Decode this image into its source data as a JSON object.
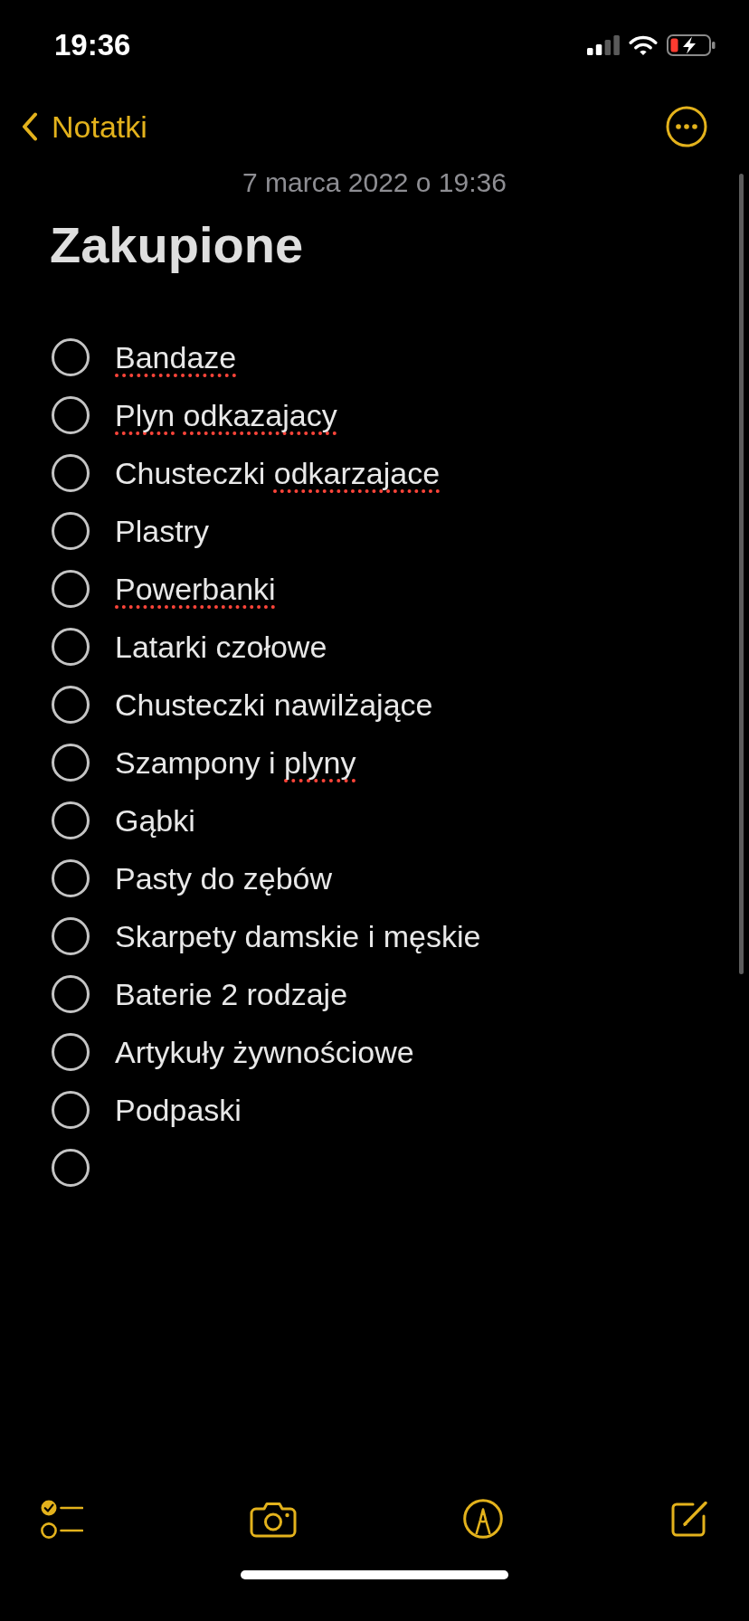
{
  "status_bar": {
    "time": "19:36"
  },
  "nav": {
    "back_label": "Notatki"
  },
  "note": {
    "date": "7 marca 2022 o 19:36",
    "title": "Zakupione",
    "checklist": [
      {
        "checked": false,
        "segments": [
          {
            "text": "Bandaze",
            "misspelled": true
          }
        ]
      },
      {
        "checked": false,
        "segments": [
          {
            "text": "Plyn ",
            "misspelled": true
          },
          {
            "text": "odkazajacy",
            "misspelled": true
          }
        ]
      },
      {
        "checked": false,
        "segments": [
          {
            "text": "Chusteczki ",
            "misspelled": false
          },
          {
            "text": "odkarzajace",
            "misspelled": true
          }
        ]
      },
      {
        "checked": false,
        "segments": [
          {
            "text": "Plastry",
            "misspelled": false
          }
        ]
      },
      {
        "checked": false,
        "segments": [
          {
            "text": "Powerbanki",
            "misspelled": true
          }
        ]
      },
      {
        "checked": false,
        "segments": [
          {
            "text": "Latarki czołowe",
            "misspelled": false
          }
        ]
      },
      {
        "checked": false,
        "segments": [
          {
            "text": "Chusteczki nawilżające",
            "misspelled": false
          }
        ]
      },
      {
        "checked": false,
        "segments": [
          {
            "text": "Szampony i ",
            "misspelled": false
          },
          {
            "text": "plyny",
            "misspelled": true
          }
        ]
      },
      {
        "checked": false,
        "segments": [
          {
            "text": "Gąbki",
            "misspelled": false
          }
        ]
      },
      {
        "checked": false,
        "segments": [
          {
            "text": "Pasty do zębów",
            "misspelled": false
          }
        ]
      },
      {
        "checked": false,
        "segments": [
          {
            "text": "Skarpety damskie i męskie",
            "misspelled": false
          }
        ]
      },
      {
        "checked": false,
        "segments": [
          {
            "text": "Baterie 2 rodzaje",
            "misspelled": false
          }
        ]
      },
      {
        "checked": false,
        "segments": [
          {
            "text": "Artykuły żywnościowe",
            "misspelled": false
          }
        ]
      },
      {
        "checked": false,
        "segments": [
          {
            "text": "Podpaski",
            "misspelled": false
          }
        ]
      },
      {
        "checked": false
      }
    ]
  }
}
